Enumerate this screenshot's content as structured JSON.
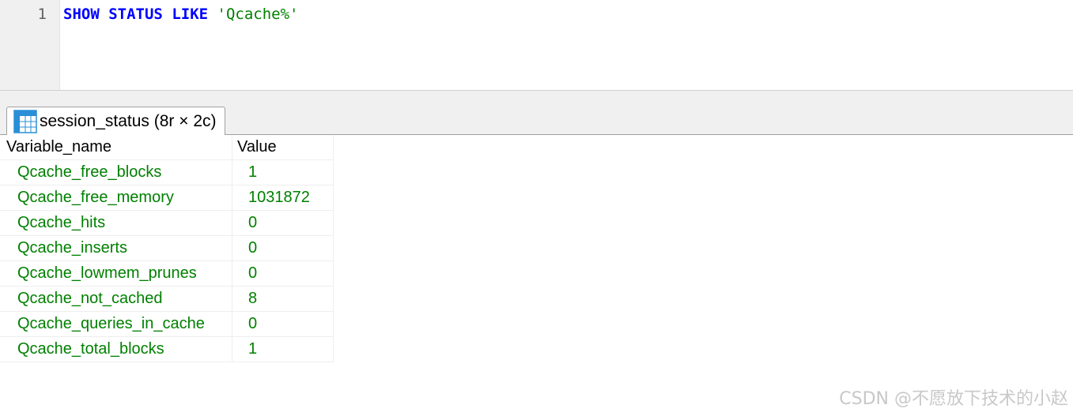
{
  "editor": {
    "line_number": "1",
    "tokens": {
      "kw1": "SHOW",
      "kw2": "STATUS",
      "kw3": "LIKE",
      "literal": "'Qcache%'"
    }
  },
  "result_tab": {
    "icon": "table-grid-icon",
    "label": "session_status (8r × 2c)"
  },
  "grid": {
    "columns": [
      "Variable_name",
      "Value"
    ],
    "rows": [
      [
        "Qcache_free_blocks",
        "1"
      ],
      [
        "Qcache_free_memory",
        "1031872"
      ],
      [
        "Qcache_hits",
        "0"
      ],
      [
        "Qcache_inserts",
        "0"
      ],
      [
        "Qcache_lowmem_prunes",
        "0"
      ],
      [
        "Qcache_not_cached",
        "8"
      ],
      [
        "Qcache_queries_in_cache",
        "0"
      ],
      [
        "Qcache_total_blocks",
        "1"
      ]
    ]
  },
  "colors": {
    "keyword": "#0000ff",
    "string_literal": "#008000",
    "cell_text": "#008000"
  },
  "watermark": "CSDN @不愿放下技术的小赵"
}
